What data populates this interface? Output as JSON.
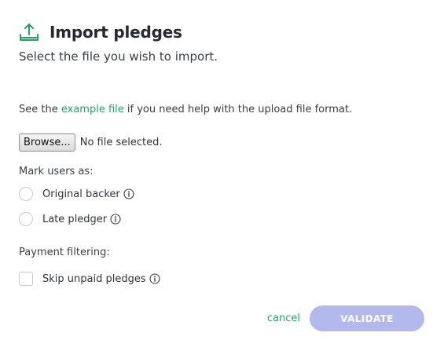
{
  "header": {
    "icon": "upload-icon",
    "title": "Import pledges",
    "subtitle": "Select the file you wish to import."
  },
  "help": {
    "prefix": "See the ",
    "link_text": "example file",
    "suffix": " if you need help with the upload file format."
  },
  "file_input": {
    "button_label": "Browse...",
    "status": "No file selected."
  },
  "mark_users": {
    "label": "Mark users as:",
    "options": [
      {
        "label": "Original backer",
        "selected": false,
        "icon": "info-icon"
      },
      {
        "label": "Late pledger",
        "selected": false,
        "icon": "info-icon"
      }
    ]
  },
  "payment_filtering": {
    "label": "Payment filtering:",
    "options": [
      {
        "label": "Skip unpaid pledges",
        "checked": false,
        "icon": "info-icon"
      }
    ]
  },
  "footer": {
    "cancel_label": "cancel",
    "validate_label": "VALIDATE"
  },
  "colors": {
    "accent_green": "#2f9a6b",
    "validate_disabled": "#b4b9ed",
    "text": "#2f3237"
  }
}
